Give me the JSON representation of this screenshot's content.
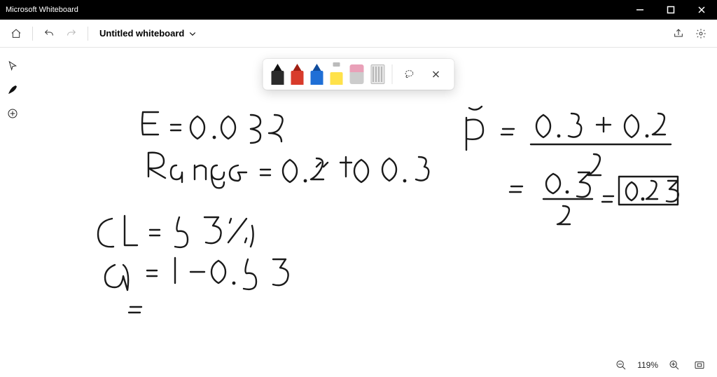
{
  "app": {
    "title": "Microsoft Whiteboard"
  },
  "window_controls": {
    "minimize": "—",
    "maximize": "▢",
    "close": "✕"
  },
  "toolbar": {
    "home_tooltip": "Home",
    "undo_tooltip": "Undo",
    "redo_tooltip": "Redo",
    "document_title": "Untitled whiteboard",
    "share_tooltip": "Share",
    "settings_tooltip": "Settings"
  },
  "left_tools": {
    "select_tooltip": "Select",
    "ink_tooltip": "Inking",
    "add_tooltip": "Add"
  },
  "pen_tray": {
    "pens": [
      {
        "name": "black-pen",
        "color": "#2b2b2b",
        "tip": "#111"
      },
      {
        "name": "red-pen",
        "color": "#d83b2b",
        "tip": "#a01f12"
      },
      {
        "name": "blue-pen",
        "color": "#1f6fd6",
        "tip": "#104c9c"
      },
      {
        "name": "yellow-highlighter",
        "color": "#ffe24a",
        "tip": "#e6c700"
      }
    ],
    "eraser_tooltip": "Eraser",
    "ruler_tooltip": "Ruler",
    "lasso_tooltip": "Lasso select",
    "close_tooltip": "Close toolbar"
  },
  "status": {
    "zoom_out_tooltip": "Zoom out",
    "zoom_label": "119%",
    "zoom_in_tooltip": "Zoom in",
    "fit_tooltip": "Fit to screen"
  },
  "ink_content": {
    "lines": [
      "E = 0.035",
      "Range = 0.2 to 0.3",
      "CL = 95%",
      "α = 1 - 0.95",
      "=",
      "p̂ = (0.3 + 0.2) / 2",
      "= 0.5 / 2 = 0.25"
    ]
  }
}
